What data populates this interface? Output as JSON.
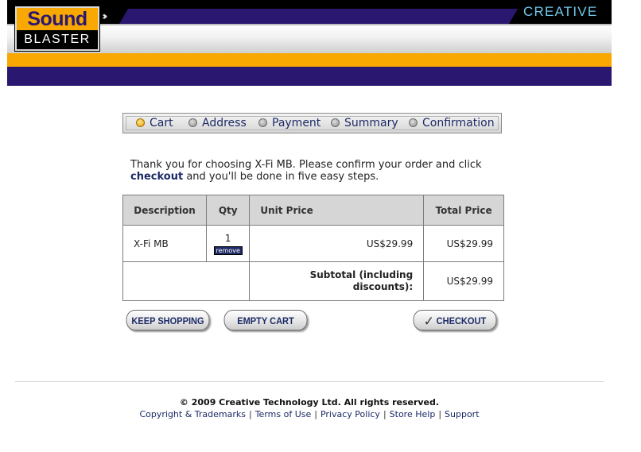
{
  "header": {
    "logo_top": "Sound",
    "logo_bottom": "BLASTER",
    "chevrons": "››",
    "brand": "CREATIVE"
  },
  "steps": [
    {
      "label": "Cart",
      "active": true
    },
    {
      "label": "Address",
      "active": false
    },
    {
      "label": "Payment",
      "active": false
    },
    {
      "label": "Summary",
      "active": false
    },
    {
      "label": "Confirmation",
      "active": false
    }
  ],
  "intro": {
    "text_before": "Thank you for choosing X-Fi MB. Please confirm your order and click",
    "link": "checkout",
    "text_after": "and you'll be done in five easy steps."
  },
  "cart": {
    "headers": {
      "description": "Description",
      "qty": "Qty",
      "unit_price": "Unit Price",
      "total_price": "Total Price"
    },
    "item": {
      "description": "X-Fi MB",
      "qty": "1",
      "remove": "remove",
      "unit_price": "US$29.99",
      "total_price": "US$29.99"
    },
    "subtotal_label": "Subtotal (including discounts):",
    "subtotal_value": "US$29.99"
  },
  "buttons": {
    "keep_shopping": "KEEP SHOPPING",
    "empty_cart": "EMPTY CART",
    "checkout": "CHECKOUT"
  },
  "footer": {
    "copyright": "© 2009 Creative Technology Ltd. All rights reserved.",
    "links": [
      "Copyright & Trademarks",
      "Terms of Use",
      "Privacy Policy",
      "Store Help",
      "Support"
    ]
  },
  "colors": {
    "accent_orange": "#f8a800",
    "brand_purple": "#2a1870",
    "link_navy": "#1c2a66",
    "creative_blue": "#6ec8ea"
  }
}
